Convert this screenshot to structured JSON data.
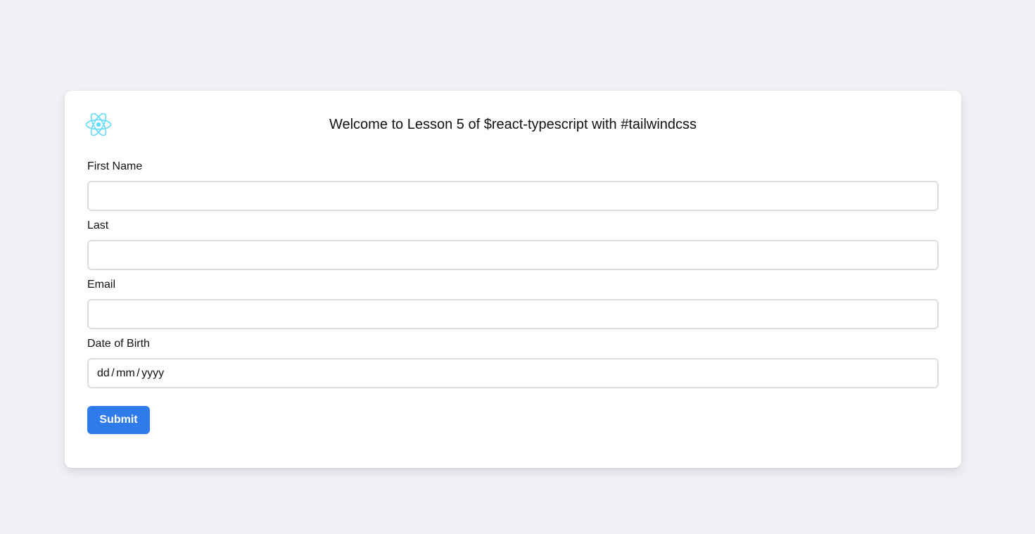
{
  "header": {
    "logo_icon": "react-atom-icon",
    "logo_color": "#61dafb",
    "title": "Welcome to Lesson 5 of $react-typescript with #tailwindcss"
  },
  "form": {
    "first_name": {
      "label": "First Name",
      "value": ""
    },
    "last_name": {
      "label": "Last",
      "value": ""
    },
    "email": {
      "label": "Email",
      "value": ""
    },
    "date_of_birth": {
      "label": "Date of Birth",
      "placeholder": "dd / mm / yyyy"
    },
    "submit_label": "Submit"
  },
  "colors": {
    "page_background": "#f0f1f5",
    "card_background": "#ffffff",
    "accent": "#2f7beb",
    "input_border": "#dcdde0"
  }
}
